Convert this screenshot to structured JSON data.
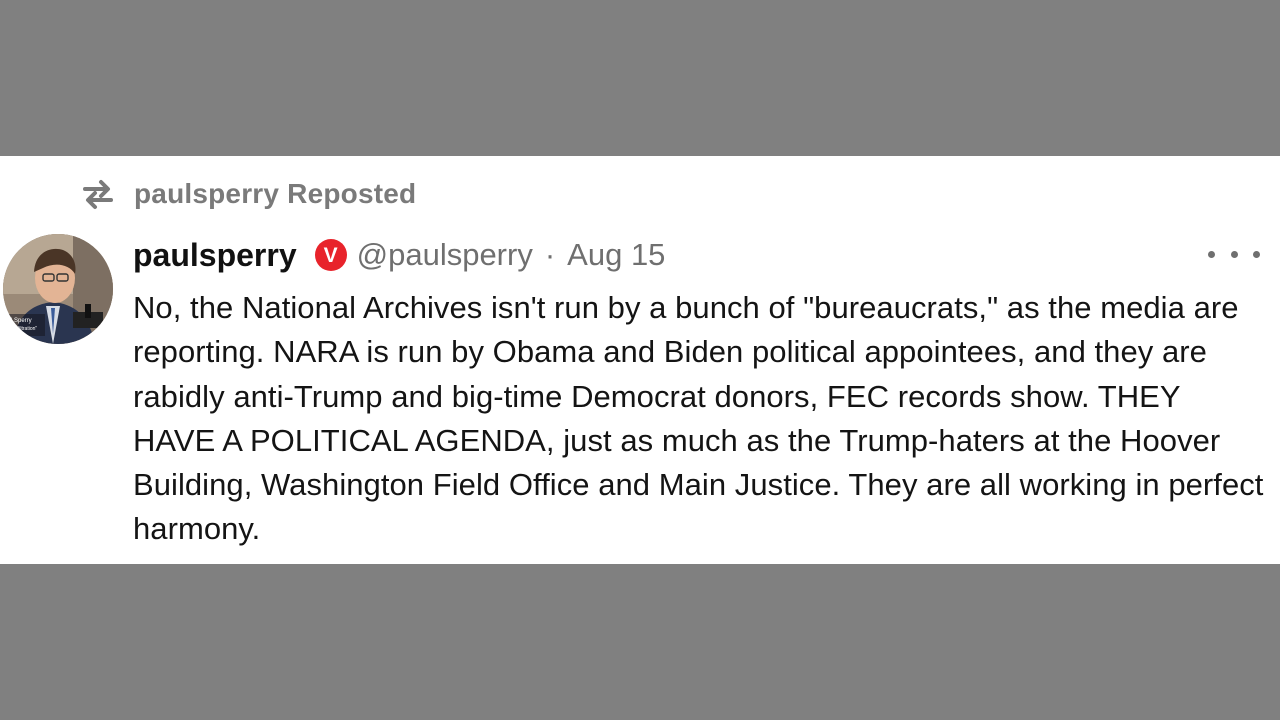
{
  "repost": {
    "icon": "repost-arrows-icon",
    "label": "paulsperry Reposted"
  },
  "post": {
    "avatar": "profile-photo",
    "display_name": "paulsperry",
    "verified_badge": "V",
    "verified_color": "#e8232b",
    "handle": "@paulsperry",
    "separator": "·",
    "date": "Aug 15",
    "more_icon": "more-horizontal-icon",
    "body": "No, the National Archives isn't run by a bunch of \"bureaucrats,\" as the media are reporting. NARA is run by Obama and Biden political appointees, and they are rabidly anti-Trump and big-time Democrat donors, FEC records show. THEY HAVE A POLITICAL AGENDA, just as much as the Trump-haters at the Hoover Building, Washington Field Office and Main Justice. They are all working in perfect harmony."
  },
  "avatar_caption": {
    "line1": "l Sperry",
    "line2": "or, \"Infiltration\""
  }
}
